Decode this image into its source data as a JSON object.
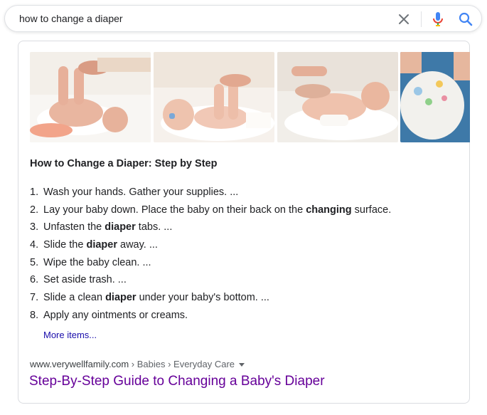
{
  "search": {
    "query": "how to change a diaper",
    "clear_icon": "close-icon",
    "mic_icon": "microphone-icon",
    "search_icon": "search-icon"
  },
  "images": [
    {
      "alt": "baby on changing mat with legs lifted",
      "icon": "image-thumbnail"
    },
    {
      "alt": "baby with pacifier getting diaper changed",
      "icon": "image-thumbnail"
    },
    {
      "alt": "baby lying on changing table",
      "icon": "image-thumbnail"
    },
    {
      "alt": "diaper close-up",
      "icon": "image-thumbnail"
    }
  ],
  "snippet": {
    "title": "How to Change a Diaper: Step by Step",
    "steps": [
      {
        "num": "1.",
        "parts": [
          {
            "t": "Wash your hands. Gather your supplies. ...",
            "b": false
          }
        ]
      },
      {
        "num": "2.",
        "parts": [
          {
            "t": "Lay your baby down. Place the baby on their back on the ",
            "b": false
          },
          {
            "t": "changing",
            "b": true
          },
          {
            "t": " surface.",
            "b": false
          }
        ]
      },
      {
        "num": "3.",
        "parts": [
          {
            "t": "Unfasten the ",
            "b": false
          },
          {
            "t": "diaper",
            "b": true
          },
          {
            "t": " tabs. ...",
            "b": false
          }
        ]
      },
      {
        "num": "4.",
        "parts": [
          {
            "t": "Slide the ",
            "b": false
          },
          {
            "t": "diaper",
            "b": true
          },
          {
            "t": " away. ...",
            "b": false
          }
        ]
      },
      {
        "num": "5.",
        "parts": [
          {
            "t": "Wipe the baby clean. ...",
            "b": false
          }
        ]
      },
      {
        "num": "6.",
        "parts": [
          {
            "t": "Set aside trash. ...",
            "b": false
          }
        ]
      },
      {
        "num": "7.",
        "parts": [
          {
            "t": "Slide a clean ",
            "b": false
          },
          {
            "t": "diaper",
            "b": true
          },
          {
            "t": " under your baby's bottom. ...",
            "b": false
          }
        ]
      },
      {
        "num": "8.",
        "parts": [
          {
            "t": "Apply any ointments or creams.",
            "b": false
          }
        ]
      }
    ],
    "more_items": "More items..."
  },
  "result": {
    "domain": "www.verywellfamily.com",
    "breadcrumbs": " › Babies › Everyday Care",
    "title": "Step-By-Step Guide to Changing a Baby's Diaper"
  },
  "colors": {
    "link_visited": "#660099",
    "link": "#1a0dab",
    "mic_blue": "#4285f4",
    "mic_red": "#ea4335"
  }
}
